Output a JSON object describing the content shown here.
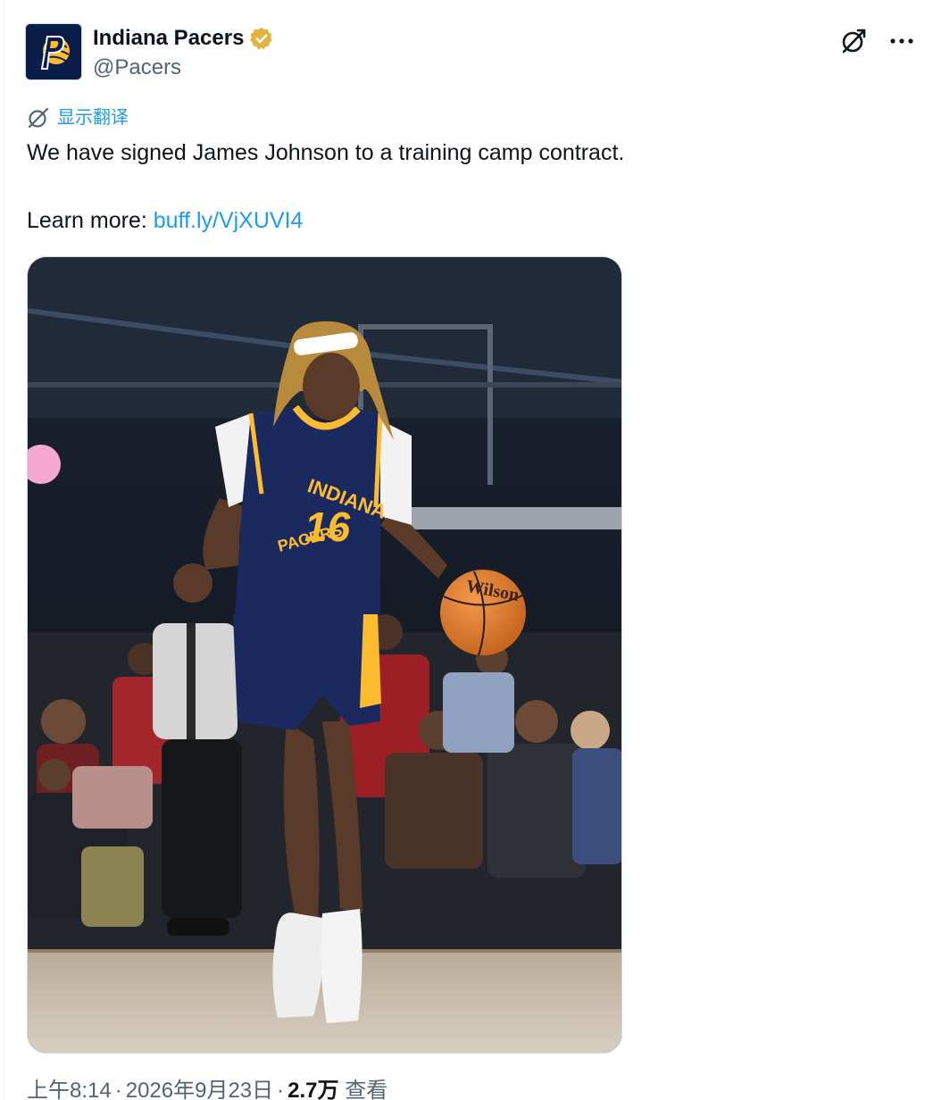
{
  "author": {
    "display_name": "Indiana Pacers",
    "handle": "@Pacers",
    "verified": true,
    "verified_color": "#e2b33d",
    "avatar_bg": "#0b1e4a",
    "avatar_accent": "#fdbb30"
  },
  "actions": {
    "grok_icon": "grok-icon",
    "more_icon": "more-icon"
  },
  "translate": {
    "label": "显示翻译",
    "icon": "translate-icon"
  },
  "tweet": {
    "line1": "We have signed James Johnson to a training camp contract.",
    "learn_prefix": "Learn more: ",
    "link_text": "buff.ly/VjXUVI4",
    "link_color": "#1d9bf0"
  },
  "media": {
    "jersey_team": "INDIANA",
    "jersey_team_bottom": "PACERS",
    "jersey_number": "16",
    "ball_brand": "Wilson",
    "jersey_color": "#1a2a5e",
    "jersey_trim": "#fdbb30"
  },
  "meta": {
    "time": "上午8:14",
    "date": "2026年9月23日",
    "views_count": "2.7万",
    "views_label": "查看",
    "separator": "·"
  }
}
